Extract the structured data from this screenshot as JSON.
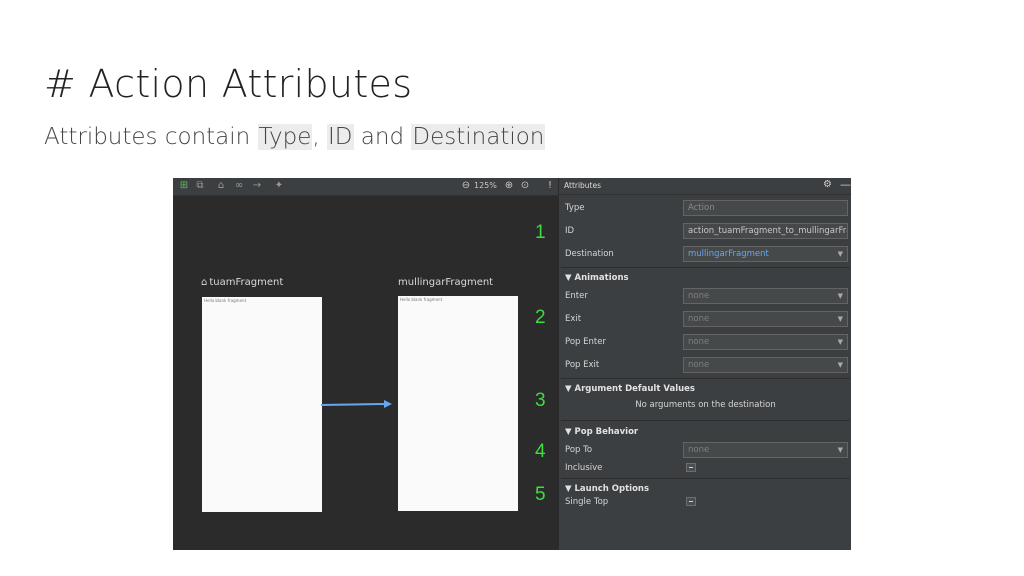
{
  "slide": {
    "title": "# Action Attributes",
    "subtitle_prefix": "Attributes contain ",
    "subtitle_type": "Type",
    "subtitle_sep1": ", ",
    "subtitle_id": "ID",
    "subtitle_sep2": " and ",
    "subtitle_destination": "Destination"
  },
  "toolbar": {
    "icons": [
      "add-destination-icon",
      "nested-graph-icon",
      "home-icon",
      "link-icon",
      "action-arrow-icon",
      "auto-arrange-icon",
      "zoom-out-icon",
      "zoom-in-icon",
      "zoom-fit-icon",
      "info-icon"
    ],
    "zoom": "125%",
    "info": "!"
  },
  "graph": {
    "fragments": [
      {
        "label": "tuamFragment",
        "inner_text": "Hello blank fragment",
        "is_start": true
      },
      {
        "label": "mullingarFragment",
        "inner_text": "Hello blank fragment",
        "is_start": false
      }
    ],
    "annotation_numbers": [
      "1",
      "2",
      "3",
      "4",
      "5"
    ],
    "arrow_color": "#6aa5f0"
  },
  "attributes": {
    "panel_title": "Attributes",
    "type_label": "Type",
    "type_placeholder": "Action",
    "id_label": "ID",
    "id_value": "action_tuamFragment_to_mullingarFrag",
    "destination_label": "Destination",
    "destination_value": "mullingarFragment",
    "animations_title": "▼ Animations",
    "enter_label": "Enter",
    "exit_label": "Exit",
    "pop_enter_label": "Pop Enter",
    "pop_exit_label": "Pop Exit",
    "none": "none",
    "arg_defaults_title": "▼ Argument Default Values",
    "no_args_text": "No arguments on the destination",
    "pop_behavior_title": "▼ Pop Behavior",
    "pop_to_label": "Pop To",
    "inclusive_label": "Inclusive",
    "launch_options_title": "▼ Launch Options",
    "single_top_label": "Single Top"
  },
  "colors": {
    "annotation_green": "#3fdc3f",
    "panel_bg": "#3c3f41",
    "canvas_bg": "#2b2b2b",
    "link_blue": "#6aa5f0"
  }
}
